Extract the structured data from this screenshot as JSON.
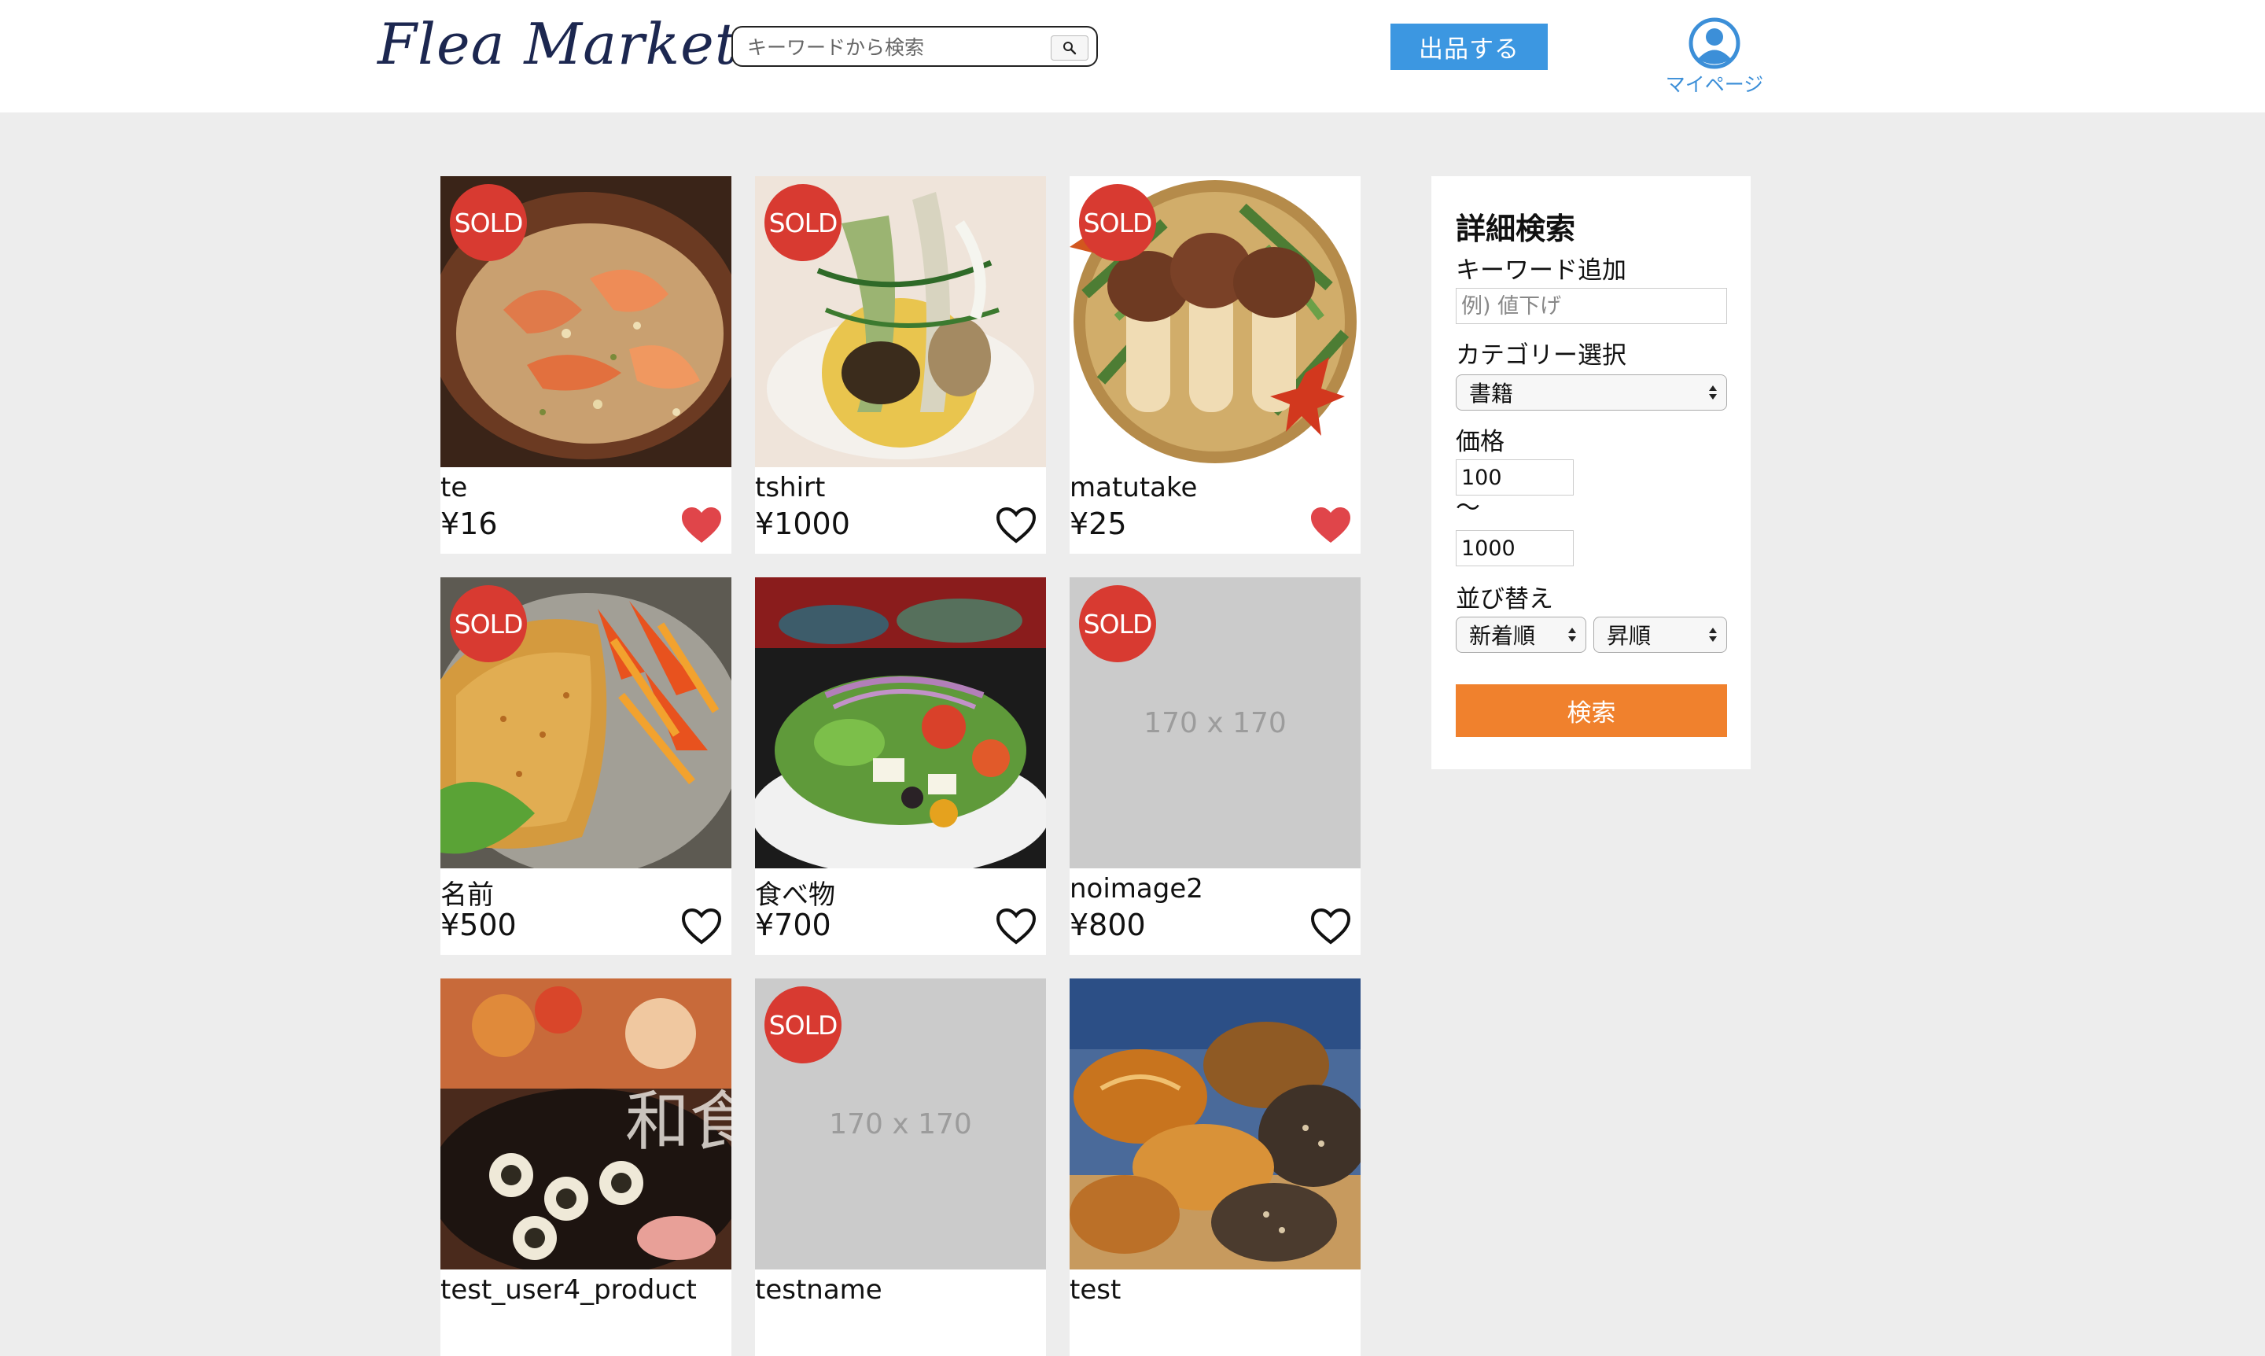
{
  "header": {
    "logo": "Flea Market",
    "search_placeholder": "キーワードから検索",
    "sell_button": "出品する",
    "mypage_label": "マイページ"
  },
  "products": [
    {
      "name": "te",
      "price": "¥16",
      "sold": true,
      "favorited": true,
      "image": "shrimp-dish"
    },
    {
      "name": "tshirt",
      "price": "¥1000",
      "sold": true,
      "favorited": false,
      "image": "vegetable-dish"
    },
    {
      "name": "matutake",
      "price": "¥25",
      "sold": true,
      "favorited": true,
      "image": "matsutake-illustration"
    },
    {
      "name": "名前",
      "price": "¥500",
      "sold": true,
      "favorited": false,
      "image": "fried-cutlet"
    },
    {
      "name": "食べ物",
      "price": "¥700",
      "sold": false,
      "favorited": false,
      "image": "salad-plate"
    },
    {
      "name": "noimage2",
      "price": "¥800",
      "sold": true,
      "favorited": false,
      "image": "placeholder",
      "placeholder_text": "170 x 170"
    },
    {
      "name": "test_user4_product",
      "price": "",
      "sold": false,
      "favorited": false,
      "image": "japanese-food",
      "overlay_text": "和食"
    },
    {
      "name": "testname",
      "price": "",
      "sold": true,
      "favorited": false,
      "image": "placeholder",
      "placeholder_text": "170 x 170"
    },
    {
      "name": "test",
      "price": "",
      "sold": false,
      "favorited": false,
      "image": "bread"
    }
  ],
  "sold_badge": "SOLD",
  "sidebar": {
    "title": "詳細検索",
    "keyword_label": "キーワード追加",
    "keyword_placeholder": "例) 値下げ",
    "category_label": "カテゴリー選択",
    "category_value": "書籍",
    "price_label": "価格",
    "price_min": "100",
    "price_separator": "〜",
    "price_max": "1000",
    "sort_label": "並び替え",
    "sort_value": "新着順",
    "order_value": "昇順",
    "submit": "検索"
  },
  "colors": {
    "page_bg": "#ededed",
    "sold": "#d83a31",
    "sell_button": "#3c97e1",
    "search_button": "#f0812d",
    "heart_filled": "#e0454a",
    "logo": "#1c2750"
  }
}
